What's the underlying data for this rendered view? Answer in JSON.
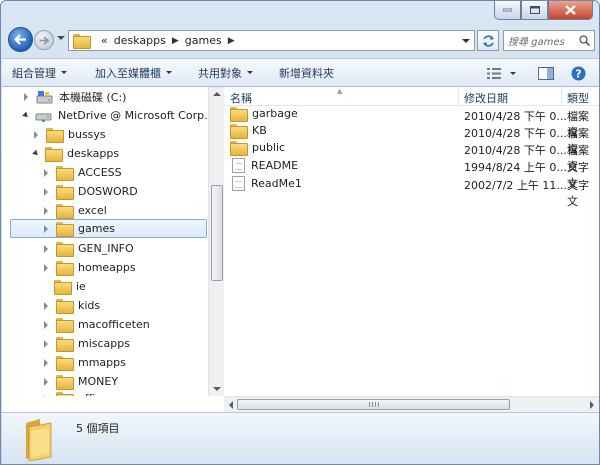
{
  "address": {
    "crumbs": [
      "«",
      "deskapps",
      "games"
    ],
    "search_placeholder": "搜尋 games"
  },
  "toolbar": {
    "organize": "組合管理",
    "include_library": "加入至媒體櫃",
    "share_with": "共用對象",
    "new_folder": "新增資料夾"
  },
  "tree": {
    "items": [
      {
        "label": "本機磁碟 (C:)"
      },
      {
        "label": "NetDrive @ Microsoft Corp., Inte"
      },
      {
        "label": "bussys"
      },
      {
        "label": "deskapps"
      },
      {
        "label": "ACCESS"
      },
      {
        "label": "DOSWORD"
      },
      {
        "label": "excel"
      },
      {
        "label": "games"
      },
      {
        "label": "GEN_INFO"
      },
      {
        "label": "homeapps"
      },
      {
        "label": "ie"
      },
      {
        "label": "kids"
      },
      {
        "label": "macofficeten"
      },
      {
        "label": "miscapps"
      },
      {
        "label": "mmapps"
      },
      {
        "label": "MONEY"
      },
      {
        "label": "office"
      }
    ]
  },
  "columns": {
    "name": "名稱",
    "date": "修改日期",
    "type": "類型"
  },
  "files": [
    {
      "name": "garbage",
      "date": "2010/4/28 下午 0...",
      "type": "檔案資"
    },
    {
      "name": "KB",
      "date": "2010/4/28 下午 0...",
      "type": "檔案資"
    },
    {
      "name": "public",
      "date": "2010/4/28 下午 0...",
      "type": "檔案資"
    },
    {
      "name": "README",
      "date": "1994/8/24 上午 0...",
      "type": "文字文"
    },
    {
      "name": "ReadMe1",
      "date": "2002/7/2 上午 11...",
      "type": "文字文"
    }
  ],
  "status": {
    "count": "5 個項目"
  },
  "colors": {
    "selection_border": "#84acdd",
    "folder": "#e7b441",
    "chrome": "#c4d6ea"
  }
}
